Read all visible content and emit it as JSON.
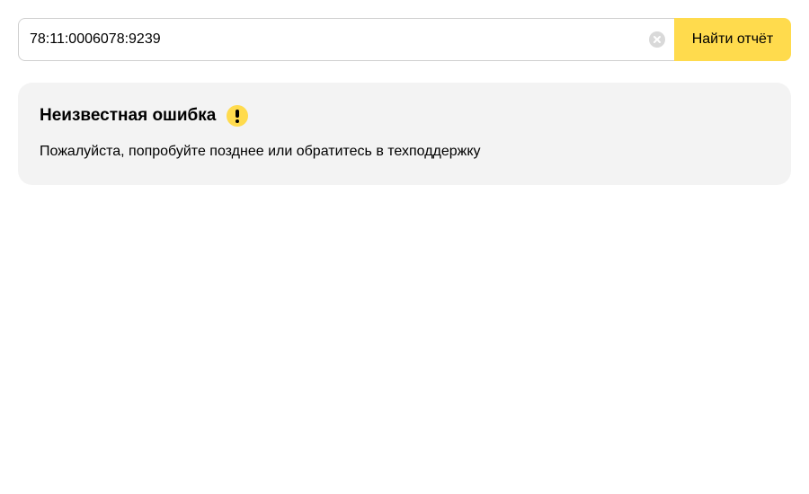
{
  "search": {
    "value": "78:11:0006078:9239",
    "clear_icon": "close-circle-icon",
    "button_label": "Найти отчёт",
    "button_color": "#ffdb4d"
  },
  "error": {
    "title": "Неизвестная ошибка",
    "icon": "warning-exclamation-icon",
    "icon_color": "#ffdb4d",
    "message": "Пожалуйста, попробуйте позднее или обратитесь в техподдержку",
    "background": "#f3f3f3"
  }
}
